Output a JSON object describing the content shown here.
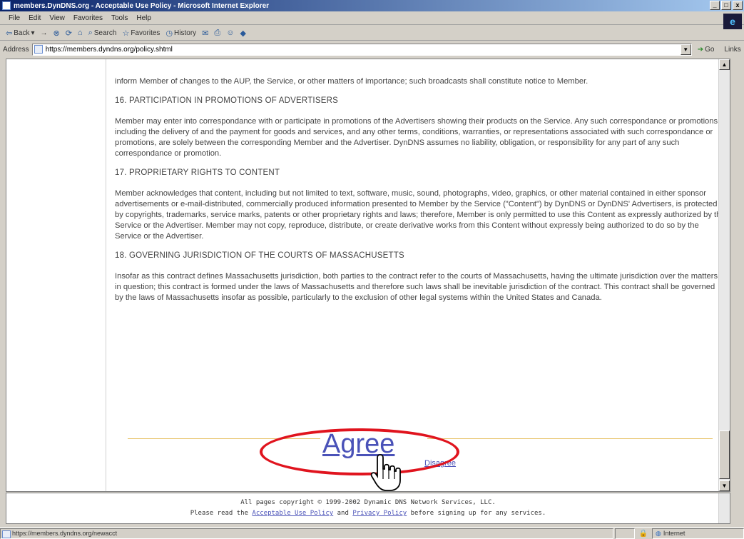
{
  "window": {
    "title": "members.DynDNS.org - Acceptable Use Policy - Microsoft Internet Explorer",
    "controls": {
      "minimize": "_",
      "maximize": "□",
      "close": "x"
    }
  },
  "menu": [
    "File",
    "Edit",
    "View",
    "Favorites",
    "Tools",
    "Help"
  ],
  "toolbar": {
    "back": "Back",
    "forward": "→",
    "search": "Search",
    "favorites": "Favorites",
    "history": "History"
  },
  "address": {
    "label": "Address",
    "url": "https://members.dyndns.org/policy.shtml",
    "go": "Go",
    "links": "Links"
  },
  "document": {
    "intro": "inform Member of changes to the AUP, the Service, or other matters of importance; such broadcasts shall constitute notice to Member.",
    "sections": [
      {
        "title": "16. PARTICIPATION IN PROMOTIONS OF ADVERTISERS",
        "body": "Member may enter into correspondance with or participate in promotions of the Advertisers showing their products on the Service. Any such correspondance or promotions, including the delivery of and the payment for goods and services, and any other terms, conditions, warranties, or representations associated with such correspondance or promotions, are solely between the corresponding Member and the Advertiser. DynDNS assumes no liability, obligation, or responsibility for any part of any such correspondance or promotion."
      },
      {
        "title": "17. PROPRIETARY RIGHTS TO CONTENT",
        "body": "Member acknowledges that content, including but not limited to text, software, music, sound, photographs, video, graphics, or other material contained in either sponsor advertisements or e-mail-distributed, commercially produced information presented to Member by the Service (\"Content\") by DynDNS or DynDNS' Advertisers, is protected by copyrights, trademarks, service marks, patents or other proprietary rights and laws; therefore, Member is only permitted to use this Content as expressly authorized by the Service or the Advertiser. Member may not copy, reproduce, distribute, or create derivative works from this Content without expressly being authorized to do so by the Service or the Advertiser."
      },
      {
        "title": "18. GOVERNING JURISDICTION OF THE COURTS OF MASSACHUSETTS",
        "body": "Insofar as this contract defines Massachusetts jurisdiction, both parties to the contract refer to the courts of Massachusetts, having the ultimate jurisdiction over the matters in question; this contract is formed under the laws of Massachusetts and therefore such laws shall be inevitable jurisdiction of the contract. This contract shall be governed by the laws of Massachusetts insofar as possible, particularly to the exclusion of other legal systems within the United States and Canada."
      }
    ],
    "agree": "Agree",
    "disagree": "Disagree"
  },
  "footer": {
    "copyright": "All pages copyright © 1999-2002 Dynamic DNS Network Services, LLC.",
    "line2_prefix": "Please read the",
    "aup_link": "Acceptable Use Policy",
    "and": "and",
    "privacy_link": "Privacy Policy",
    "line2_suffix": "before signing up for any services."
  },
  "status": {
    "text": "https://members.dyndns.org/newacct",
    "zone": "Internet"
  },
  "annotation": {
    "color": "#e0141e"
  }
}
